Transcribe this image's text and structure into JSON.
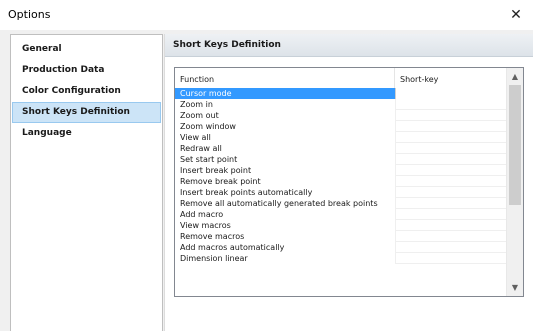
{
  "window": {
    "title": "Options",
    "close_glyph": "✕"
  },
  "nav": {
    "items": [
      {
        "label": "General"
      },
      {
        "label": "Production Data"
      },
      {
        "label": "Color Configuration"
      },
      {
        "label": "Short Keys Definition"
      },
      {
        "label": "Language"
      }
    ],
    "selected_index": 3
  },
  "panel": {
    "header": "Short Keys Definition",
    "columns": {
      "function": "Function",
      "shortkey": "Short-key"
    },
    "rows": [
      {
        "function": "Cursor mode",
        "shortkey": ""
      },
      {
        "function": "Zoom in",
        "shortkey": ""
      },
      {
        "function": "Zoom out",
        "shortkey": ""
      },
      {
        "function": "Zoom window",
        "shortkey": ""
      },
      {
        "function": "View all",
        "shortkey": ""
      },
      {
        "function": "Redraw all",
        "shortkey": ""
      },
      {
        "function": "Set start point",
        "shortkey": ""
      },
      {
        "function": "Insert break point",
        "shortkey": ""
      },
      {
        "function": "Remove break point",
        "shortkey": ""
      },
      {
        "function": "Insert break points automatically",
        "shortkey": ""
      },
      {
        "function": "Remove all automatically generated break points",
        "shortkey": ""
      },
      {
        "function": "Add macro",
        "shortkey": ""
      },
      {
        "function": "View macros",
        "shortkey": ""
      },
      {
        "function": "Remove macros",
        "shortkey": ""
      },
      {
        "function": "Add macros automatically",
        "shortkey": ""
      },
      {
        "function": "Dimension linear",
        "shortkey": ""
      }
    ],
    "selected_row": 0,
    "scroll_up_glyph": "▲",
    "scroll_down_glyph": "▼"
  },
  "colors": {
    "selection": "#3399ff",
    "nav_selection": "#cce4f7"
  }
}
